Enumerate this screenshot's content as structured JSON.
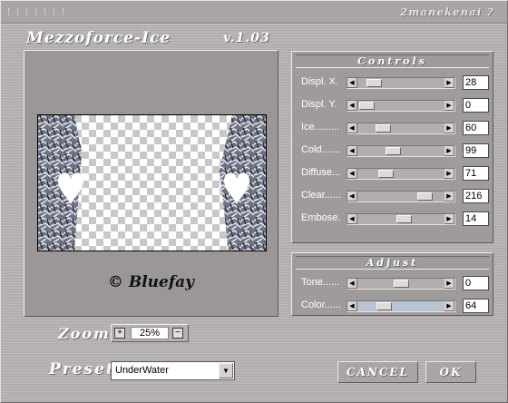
{
  "titlebar": {
    "author": "2manekenai ?"
  },
  "header": {
    "app_name": "Mezzoforce-Ice",
    "version": "v.1.03"
  },
  "preview": {
    "signature": "© Bluefay"
  },
  "controls": {
    "title": "Controls",
    "sliders": [
      {
        "label": "Displ. X.",
        "value": "28",
        "level": 0.11
      },
      {
        "label": "Displ. Y.",
        "value": "0",
        "level": 0.0
      },
      {
        "label": "Ice.........",
        "value": "60",
        "level": 0.24
      },
      {
        "label": "Cold.......",
        "value": "99",
        "level": 0.39
      },
      {
        "label": "Diffuse...",
        "value": "71",
        "level": 0.28
      },
      {
        "label": "Clear......",
        "value": "216",
        "level": 0.85
      },
      {
        "label": "Embose.",
        "value": "14",
        "level": 0.55
      }
    ]
  },
  "adjust": {
    "title": "Adjust",
    "sliders": [
      {
        "label": "Tone......",
        "value": "0",
        "level": 0.5
      },
      {
        "label": "Color......",
        "value": "64",
        "level": 0.25
      }
    ]
  },
  "zoom": {
    "label": "Zoom",
    "value": "25%",
    "plus": "+",
    "minus": "−"
  },
  "preset": {
    "label": "Preset",
    "selected": "UnderWater"
  },
  "buttons": {
    "cancel": "CANCEL",
    "ok": "OK"
  },
  "colors": {
    "window_bg": "#b5b1b1",
    "panel_bg": "#9f9b9b",
    "label_text": "#ffffff",
    "color_slider_track": "#b8c4d4"
  }
}
